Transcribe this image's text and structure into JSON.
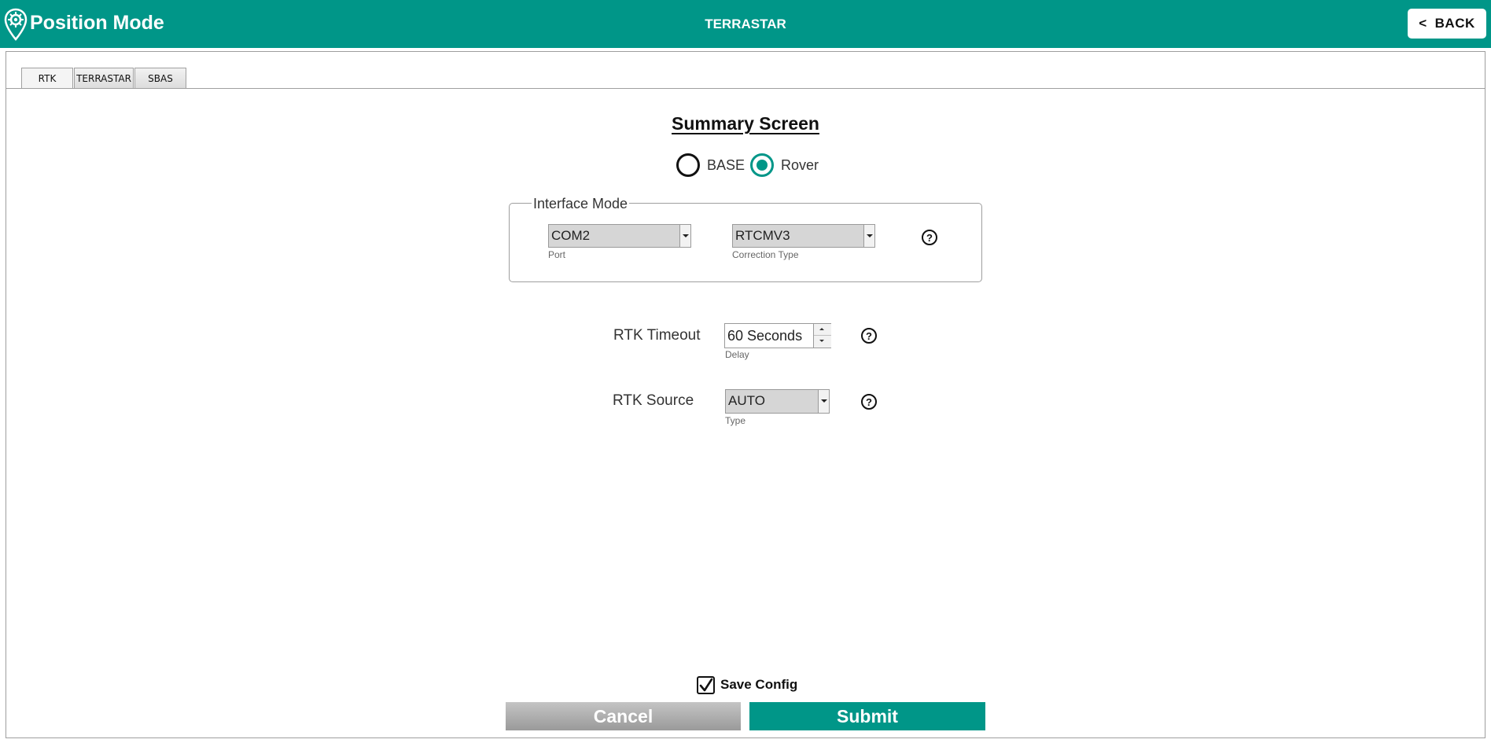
{
  "header": {
    "app_title": "Position Mode",
    "center_title": "TERRASTAR",
    "back_arrow": "<",
    "back_label": "BACK",
    "bg_color": "#009688"
  },
  "tabs": [
    {
      "label": "RTK",
      "active": true
    },
    {
      "label": "TERRASTAR",
      "active": false
    },
    {
      "label": "SBAS",
      "active": false
    }
  ],
  "summary": {
    "title": "Summary Screen",
    "mode_options": [
      {
        "label": "BASE",
        "checked": false
      },
      {
        "label": "Rover",
        "checked": true
      }
    ]
  },
  "interface_mode": {
    "legend": "Interface Mode",
    "port": {
      "value": "COM2",
      "label": "Port"
    },
    "correction_type": {
      "value": "RTCMV3",
      "label": "Correction Type"
    },
    "help_icon": "?"
  },
  "rtk_timeout": {
    "label": "RTK Timeout",
    "value": "60 Seconds",
    "sub_label": "Delay",
    "help_icon": "?"
  },
  "rtk_source": {
    "label": "RTK Source",
    "value": "AUTO",
    "sub_label": "Type",
    "help_icon": "?"
  },
  "footer": {
    "save_config_label": "Save Config",
    "save_config_checked": true,
    "cancel_label": "Cancel",
    "submit_label": "Submit"
  },
  "colors": {
    "accent": "#009688",
    "cancel_gradient_top": "#c4c4c4",
    "cancel_gradient_bottom": "#9a9a9a"
  }
}
